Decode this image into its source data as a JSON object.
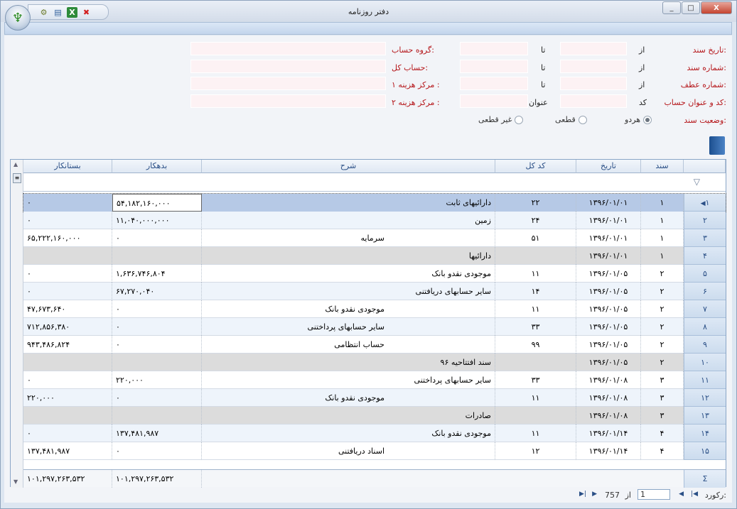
{
  "window": {
    "title": "دفتر روزنامه",
    "min": "_",
    "max": "□",
    "close": "X"
  },
  "filters": {
    "date_label": "تاریخ سند:",
    "docno_label": "شماره سند:",
    "atf_label": "شماره عطف:",
    "acct_label": "کد و عنوان حساب:",
    "status_label": "وضعیت سند:",
    "from": "از",
    "to": "تا",
    "code": "کد",
    "title_word": "عنوان",
    "group_label": "گروه حساب:",
    "general_label": "حساب کل:",
    "cost1_label": "مرکز هزینه ۱ :",
    "cost2_label": "مرکز هزینه ۲ :",
    "radio_both": "هردو",
    "radio_final": "قطعی",
    "radio_nonfinal": "غیر قطعی"
  },
  "grid": {
    "columns": {
      "doc": "سند",
      "date": "تاریخ",
      "code": "کد کل",
      "desc": "شرح",
      "debit": "بدهکار",
      "credit": "بستانکار"
    },
    "rows": [
      {
        "n": "۱",
        "doc": "۱",
        "date": "۱۳۹۶/۰۱/۰۱",
        "code": "۲۲",
        "desc": "دارائیهای ثابت",
        "desc_pos": "r",
        "debit": "۵۴,۱۸۲,۱۶۰,۰۰۰",
        "credit": "۰",
        "type": "sel"
      },
      {
        "n": "۲",
        "doc": "۱",
        "date": "۱۳۹۶/۰۱/۰۱",
        "code": "۲۴",
        "desc": "زمین",
        "desc_pos": "r",
        "debit": "۱۱,۰۴۰,۰۰۰,۰۰۰",
        "credit": "۰",
        "type": "alt"
      },
      {
        "n": "۳",
        "doc": "۱",
        "date": "۱۳۹۶/۰۱/۰۱",
        "code": "۵۱",
        "desc": "سرمایه",
        "desc_pos": "m",
        "debit": "۰",
        "credit": "۶۵,۲۲۲,۱۶۰,۰۰۰",
        "type": "norm"
      },
      {
        "n": "۴",
        "doc": "۱",
        "date": "۱۳۹۶/۰۱/۰۱",
        "code": "",
        "desc": "دارائیها",
        "desc_pos": "r",
        "debit": "",
        "credit": "",
        "type": "grp"
      },
      {
        "n": "۵",
        "doc": "۲",
        "date": "۱۳۹۶/۰۱/۰۵",
        "code": "۱۱",
        "desc": "موجودی نقدو بانک",
        "desc_pos": "r",
        "debit": "۱,۶۳۶,۷۴۶,۸۰۴",
        "credit": "۰",
        "type": "norm"
      },
      {
        "n": "۶",
        "doc": "۲",
        "date": "۱۳۹۶/۰۱/۰۵",
        "code": "۱۴",
        "desc": "سایر حسابهای دریافتنی",
        "desc_pos": "r",
        "debit": "۶۷,۲۷۰,۰۴۰",
        "credit": "۰",
        "type": "alt"
      },
      {
        "n": "۷",
        "doc": "۲",
        "date": "۱۳۹۶/۰۱/۰۵",
        "code": "۱۱",
        "desc": "موجودی نقدو بانک",
        "desc_pos": "m",
        "debit": "۰",
        "credit": "۴۷,۶۷۳,۶۴۰",
        "type": "norm"
      },
      {
        "n": "۸",
        "doc": "۲",
        "date": "۱۳۹۶/۰۱/۰۵",
        "code": "۳۳",
        "desc": "سایر حسابهای پرداختنی",
        "desc_pos": "m",
        "debit": "۰",
        "credit": "۷۱۲,۸۵۶,۳۸۰",
        "type": "alt"
      },
      {
        "n": "۹",
        "doc": "۲",
        "date": "۱۳۹۶/۰۱/۰۵",
        "code": "۹۹",
        "desc": "حساب انتظامی",
        "desc_pos": "m",
        "debit": "۰",
        "credit": "۹۴۳,۴۸۶,۸۲۴",
        "type": "norm"
      },
      {
        "n": "۱۰",
        "doc": "۲",
        "date": "۱۳۹۶/۰۱/۰۵",
        "code": "",
        "desc": "سند افتتاحیه ۹۶",
        "desc_pos": "r",
        "debit": "",
        "credit": "",
        "type": "grp"
      },
      {
        "n": "۱۱",
        "doc": "۳",
        "date": "۱۳۹۶/۰۱/۰۸",
        "code": "۳۳",
        "desc": "سایر حسابهای پرداختنی",
        "desc_pos": "r",
        "debit": "۲۲۰,۰۰۰",
        "credit": "۰",
        "type": "norm"
      },
      {
        "n": "۱۲",
        "doc": "۳",
        "date": "۱۳۹۶/۰۱/۰۸",
        "code": "۱۱",
        "desc": "موجودی نقدو بانک",
        "desc_pos": "m",
        "debit": "۰",
        "credit": "۲۲۰,۰۰۰",
        "type": "alt"
      },
      {
        "n": "۱۳",
        "doc": "۳",
        "date": "۱۳۹۶/۰۱/۰۸",
        "code": "",
        "desc": "صادرات",
        "desc_pos": "r",
        "debit": "",
        "credit": "",
        "type": "grp"
      },
      {
        "n": "۱۴",
        "doc": "۴",
        "date": "۱۳۹۶/۰۱/۱۴",
        "code": "۱۱",
        "desc": "موجودی نقدو بانک",
        "desc_pos": "r",
        "debit": "۱۳۷,۴۸۱,۹۸۷",
        "credit": "۰",
        "type": "alt"
      },
      {
        "n": "۱۵",
        "doc": "۴",
        "date": "۱۳۹۶/۰۱/۱۴",
        "code": "۱۲",
        "desc": "اسناد دریافتنی",
        "desc_pos": "m",
        "debit": "۰",
        "credit": "۱۳۷,۴۸۱,۹۸۷",
        "type": "norm"
      }
    ],
    "totals": {
      "debit": "۱۰۱,۲۹۷,۲۶۳,۵۳۲",
      "credit": "۱۰۱,۲۹۷,۲۶۳,۵۳۲",
      "sigma": "Σ"
    }
  },
  "navigator": {
    "record_label": "رکورد:",
    "current": "1",
    "of": "از",
    "total": "757"
  }
}
